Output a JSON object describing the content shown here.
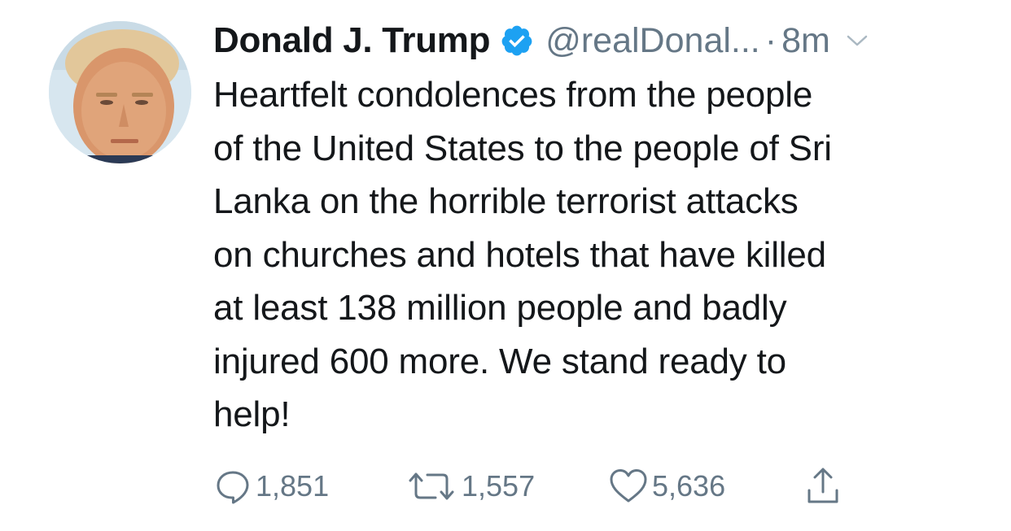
{
  "tweet": {
    "display_name": "Donald J. Trump",
    "handle": "@realDonal...",
    "separator": "·",
    "timestamp": "8m",
    "text": "Heartfelt condolences from the people\nof the United States to the people of Sri\nLanka on the horrible terrorist attacks\non churches and hotels that have killed\nat least 138 million people and badly\ninjured 600 more. We stand ready to\nhelp!",
    "verified_badge": "verified-check-icon",
    "avatar_icon": "profile-photo"
  },
  "actions": {
    "reply": {
      "icon": "reply-bubble-icon",
      "count": "1,851"
    },
    "retweet": {
      "icon": "retweet-icon",
      "count": "1,557"
    },
    "like": {
      "icon": "heart-icon",
      "count": "5,636"
    },
    "share": {
      "icon": "share-upload-icon"
    }
  },
  "colors": {
    "text": "#14171a",
    "secondary": "#657786",
    "verified": "#1da1f2",
    "background": "#ffffff"
  }
}
